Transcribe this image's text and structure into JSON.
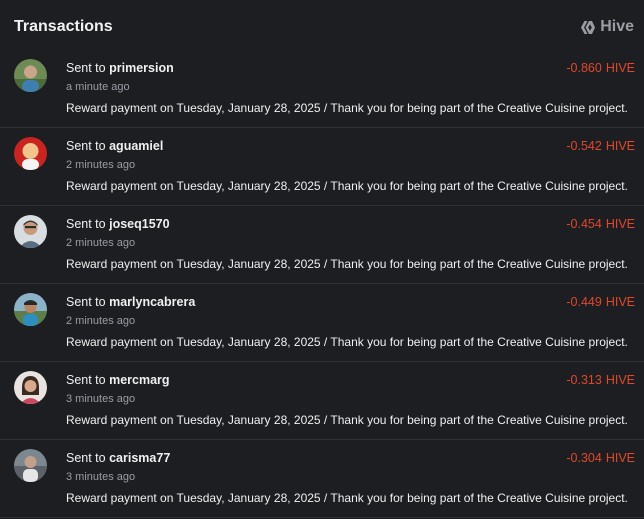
{
  "header": {
    "title": "Transactions",
    "brand_label": "Hive",
    "brand_icon": "hive-logo-icon"
  },
  "colors": {
    "background": "#1c1e22",
    "negative_amount": "#e2472b",
    "muted_text": "#9a9da3",
    "divider": "#2e3136"
  },
  "transactions": [
    {
      "direction": "Sent to",
      "user": "primersion",
      "time": "a minute ago",
      "amount": "-0.860",
      "unit": "HIVE",
      "memo": "Reward payment on Tuesday, January 28, 2025 / Thank you for being part of the Creative Cuisine project.",
      "avatar": "avatar-green"
    },
    {
      "direction": "Sent to",
      "user": "aguamiel",
      "time": "2 minutes ago",
      "amount": "-0.542",
      "unit": "HIVE",
      "memo": "Reward payment on Tuesday, January 28, 2025 / Thank you for being part of the Creative Cuisine project.",
      "avatar": "avatar-red"
    },
    {
      "direction": "Sent to",
      "user": "joseq1570",
      "time": "2 minutes ago",
      "amount": "-0.454",
      "unit": "HIVE",
      "memo": "Reward payment on Tuesday, January 28, 2025 / Thank you for being part of the Creative Cuisine project.",
      "avatar": "avatar-man"
    },
    {
      "direction": "Sent to",
      "user": "marlyncabrera",
      "time": "2 minutes ago",
      "amount": "-0.449",
      "unit": "HIVE",
      "memo": "Reward payment on Tuesday, January 28, 2025 / Thank you for being part of the Creative Cuisine project.",
      "avatar": "avatar-outdoor"
    },
    {
      "direction": "Sent to",
      "user": "mercmarg",
      "time": "3 minutes ago",
      "amount": "-0.313",
      "unit": "HIVE",
      "memo": "Reward payment on Tuesday, January 28, 2025 / Thank you for being part of the Creative Cuisine project.",
      "avatar": "avatar-woman"
    },
    {
      "direction": "Sent to",
      "user": "carisma77",
      "time": "3 minutes ago",
      "amount": "-0.304",
      "unit": "HIVE",
      "memo": "Reward payment on Tuesday, January 28, 2025 / Thank you for being part of the Creative Cuisine project.",
      "avatar": "avatar-gray"
    }
  ]
}
